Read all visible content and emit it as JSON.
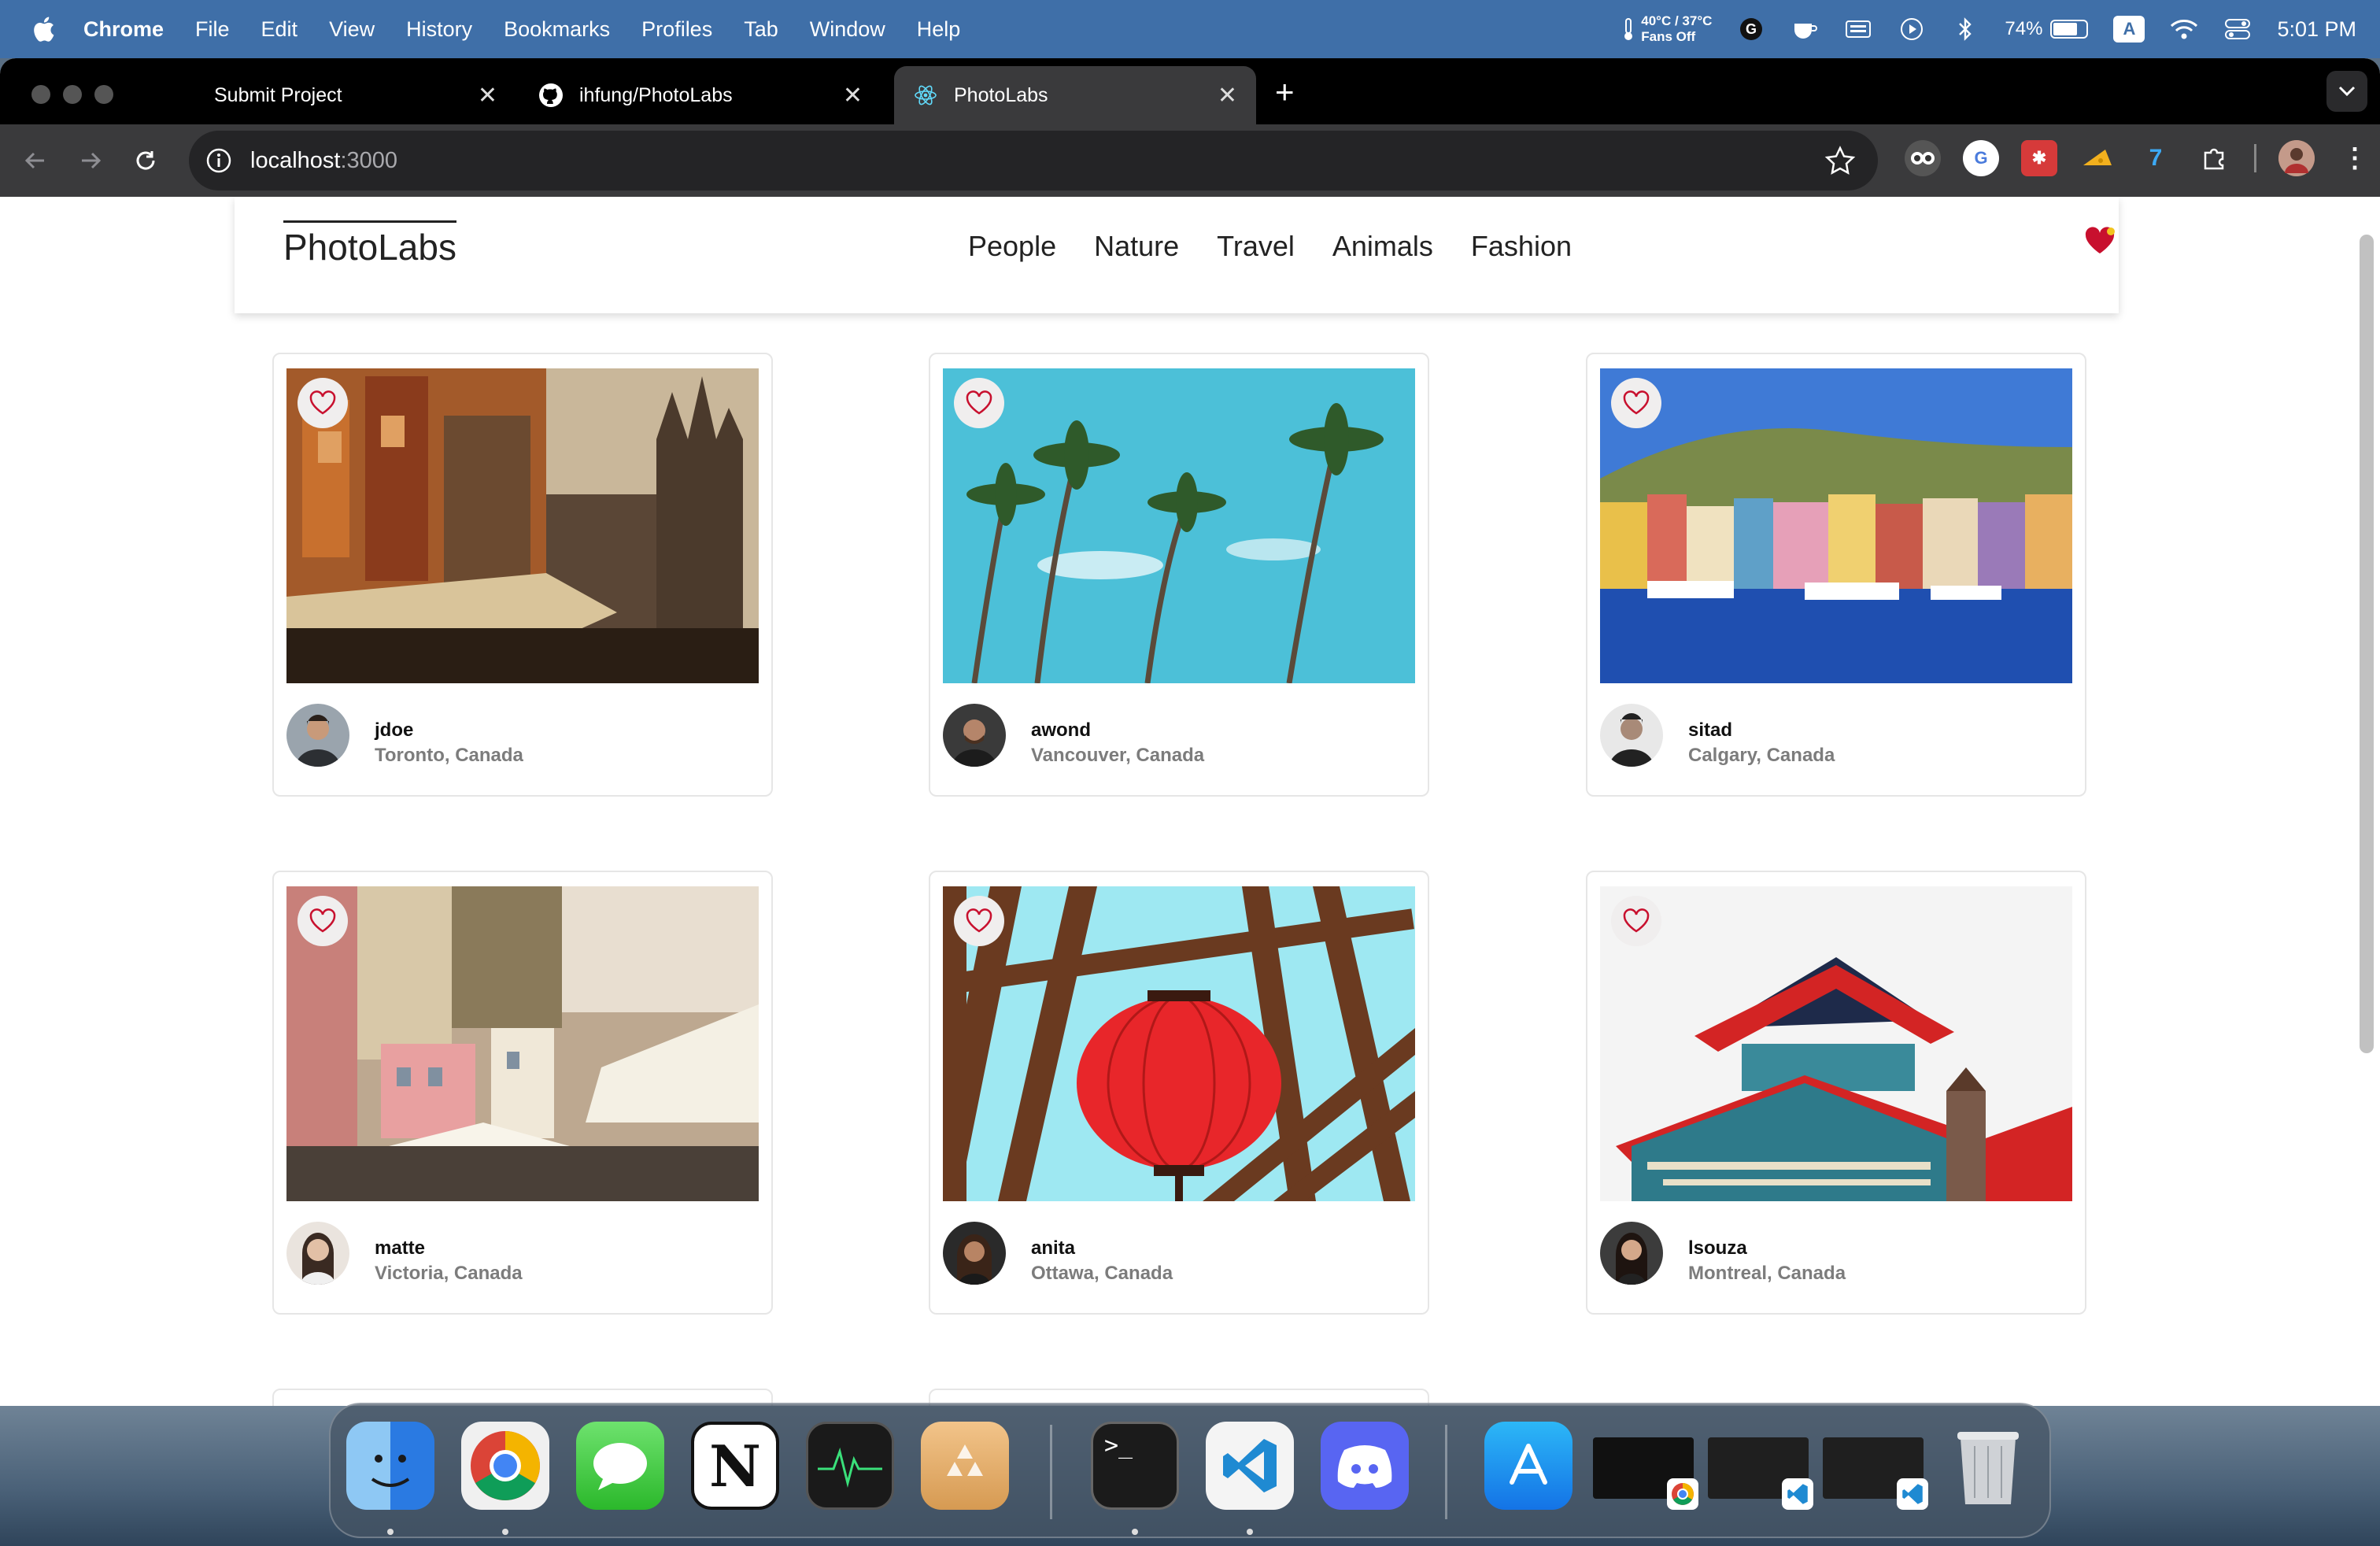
{
  "menubar": {
    "app_name": "Chrome",
    "items": [
      "File",
      "Edit",
      "View",
      "History",
      "Bookmarks",
      "Profiles",
      "Tab",
      "Window",
      "Help"
    ],
    "temperature": "40°C / 37°C",
    "fans": "Fans Off",
    "battery": "74%",
    "input_source": "A",
    "clock": "5:01 PM"
  },
  "browser": {
    "tabs": [
      {
        "title": "Submit Project",
        "favicon": "blank"
      },
      {
        "title": "ihfung/PhotoLabs",
        "favicon": "github-icon"
      },
      {
        "title": "PhotoLabs",
        "favicon": "react-icon",
        "active": true
      }
    ],
    "url_host": "localhost",
    "url_port": ":3000"
  },
  "page": {
    "logo": "PhotoLabs",
    "topics": [
      "People",
      "Nature",
      "Travel",
      "Animals",
      "Fashion"
    ],
    "photos": [
      {
        "username": "jdoe",
        "location": "Toronto, Canada",
        "scene": "old-buildings-market"
      },
      {
        "username": "awond",
        "location": "Vancouver, Canada",
        "scene": "palm-trees-sky"
      },
      {
        "username": "sitad",
        "location": "Calgary, Canada",
        "scene": "harbor-colorful-town"
      },
      {
        "username": "matte",
        "location": "Victoria, Canada",
        "scene": "hillside-town-umbrellas"
      },
      {
        "username": "anita",
        "location": "Ottawa, Canada",
        "scene": "red-lantern-pergola"
      },
      {
        "username": "lsouza",
        "location": "Montreal, Canada",
        "scene": "pagoda-building"
      }
    ]
  },
  "colors": {
    "menubar": "#3f6fa8",
    "heart": "#c8102e",
    "location_text": "#7c7c7c"
  }
}
